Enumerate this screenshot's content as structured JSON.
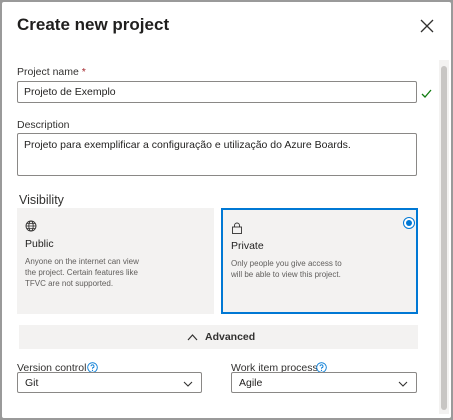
{
  "dialog": {
    "title": "Create new project",
    "close_icon": "close-icon"
  },
  "project_name": {
    "label": "Project name",
    "required_marker": "*",
    "value": "Projeto de Exemplo",
    "valid_icon": "checkmark-icon"
  },
  "description": {
    "label": "Description",
    "value": "Projeto para exemplificar a configuração e utilização do Azure Boards."
  },
  "visibility": {
    "label": "Visibility",
    "options": [
      {
        "name": "Public",
        "icon": "globe-icon",
        "description": "Anyone on the internet can view the project. Certain features like TFVC are not supported.",
        "selected": false
      },
      {
        "name": "Private",
        "icon": "lock-icon",
        "description": "Only people you give access to will be able to view this project.",
        "selected": true
      }
    ]
  },
  "advanced": {
    "label": "Advanced",
    "icon": "chevron-up-icon"
  },
  "version_control": {
    "label": "Version control",
    "help_icon": "help-icon",
    "value": "Git"
  },
  "work_item_process": {
    "label": "Work item process",
    "help_icon": "help-icon",
    "value": "Agile"
  },
  "colors": {
    "accent": "#0078d4",
    "valid": "#107c10",
    "required": "#a4262c"
  }
}
